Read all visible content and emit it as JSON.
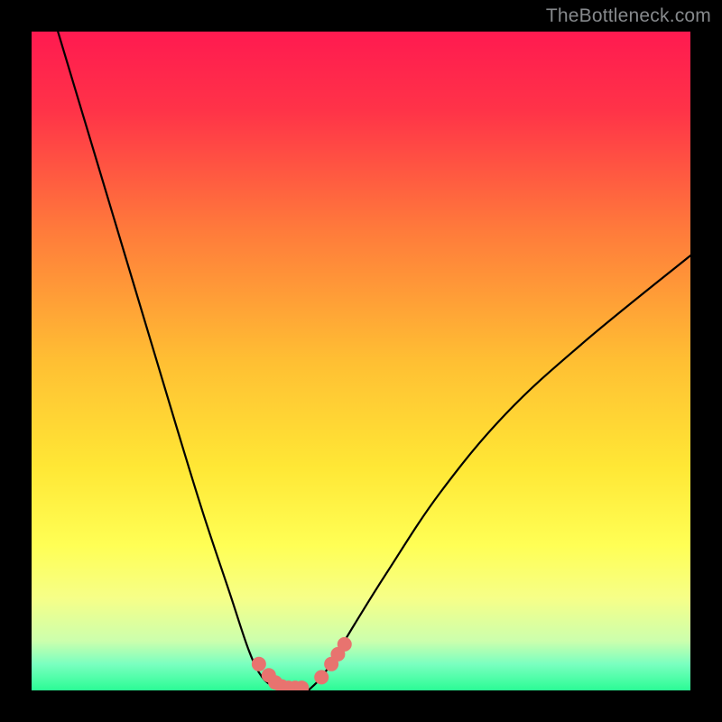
{
  "watermark": "TheBottleneck.com",
  "chart_data": {
    "type": "line",
    "title": "",
    "xlabel": "",
    "ylabel": "",
    "xlim": [
      0,
      100
    ],
    "ylim": [
      0,
      100
    ],
    "grid": false,
    "series": [
      {
        "name": "left-curve",
        "x": [
          4,
          10,
          16,
          22,
          26,
          30,
          33,
          35,
          37,
          38.5
        ],
        "values": [
          100,
          80,
          60,
          40,
          27,
          15,
          6,
          2,
          0.5,
          0
        ]
      },
      {
        "name": "right-curve",
        "x": [
          42,
          44,
          46,
          49,
          54,
          62,
          72,
          84,
          100
        ],
        "values": [
          0,
          2,
          5,
          10,
          18,
          30,
          42,
          53,
          66
        ]
      }
    ],
    "markers": {
      "name": "highlighted-points",
      "x": [
        34.5,
        36,
        37,
        38,
        39,
        40,
        41,
        44,
        45.5,
        46.5,
        47.5
      ],
      "values": [
        4,
        2.3,
        1.2,
        0.6,
        0.4,
        0.4,
        0.4,
        2,
        4,
        5.5,
        7
      ],
      "color": "#e8736f",
      "size": 8
    },
    "background_gradient": {
      "top_color": "#ff1a50",
      "mid_colors": [
        "#ff7e3a",
        "#ffd835",
        "#ffff55",
        "#f5ff8a"
      ],
      "bottom_color": "#2bfc95"
    }
  }
}
